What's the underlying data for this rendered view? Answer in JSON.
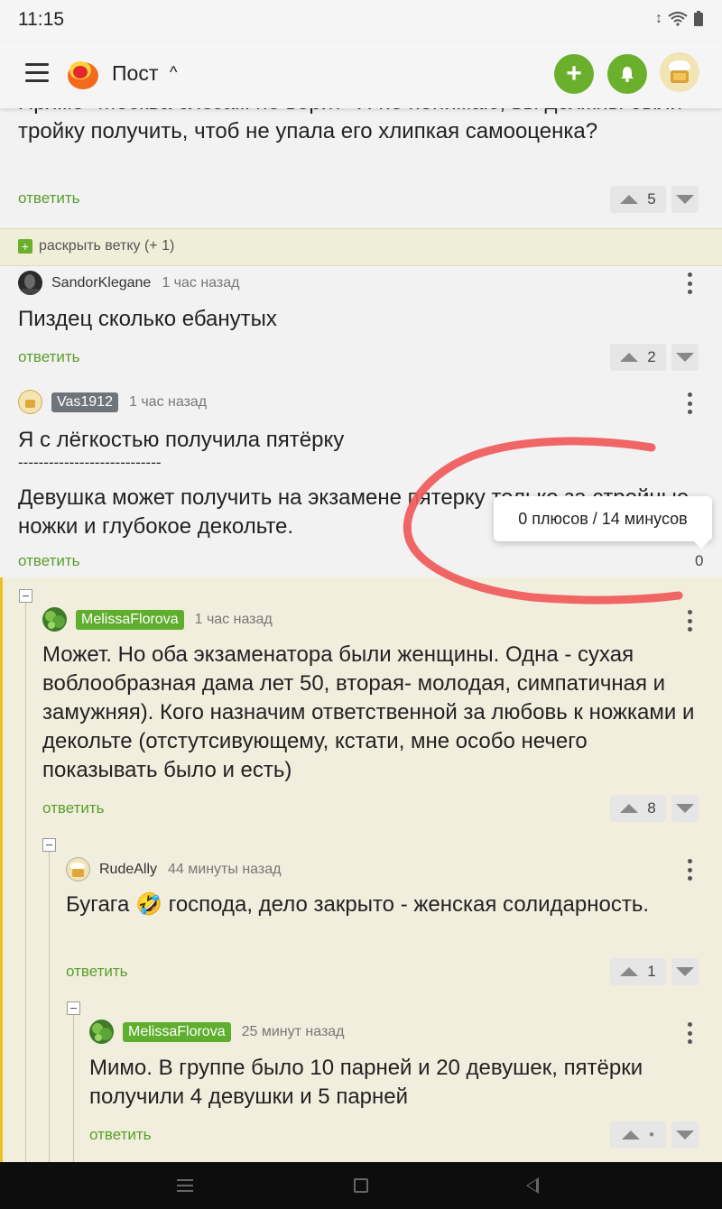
{
  "status_bar": {
    "time": "11:15",
    "icons": [
      "brightness-icon",
      "wifi-icon",
      "battery-icon"
    ]
  },
  "header": {
    "title": "Пост",
    "chevron": "^",
    "add_label": "+"
  },
  "top_comment": {
    "text": "Прямо \"Москва слезам не верит\" Я не понимаю, вы должны были тройку получить, чтоб не упала его хлипкая самооценка?",
    "reply": "ответить",
    "score": "5"
  },
  "expand_branch": {
    "label": "раскрыть ветку (+ 1)"
  },
  "comments": [
    {
      "user": "SandorKlegane",
      "time": "1 час назад",
      "text": "Пиздец сколько ебанутых",
      "reply": "ответить",
      "score": "2"
    },
    {
      "user": "Vas1912",
      "time": "1 час назад",
      "text_line1": "Я с лёгкостью получила пятёрку",
      "separator": "----------------------------",
      "text_line2": "Девушка может получить на экзамене пятерку только за стройные ножки и глубокое декольте.",
      "reply": "ответить",
      "score": "0",
      "tooltip": "0 плюсов / 14 минусов"
    },
    {
      "user": "MelissaFlorova",
      "time": "1 час назад",
      "text": "Может. Но оба экзаменатора были женщины. Одна - сухая воблообразная дама лет 50, вторая- молодая, симпатичная и замужняя). Кого назначим ответственной за любовь к ножками и декольте (отстутсивующему, кстати, мне особо нечего показывать было и есть)",
      "reply": "ответить",
      "score": "8"
    },
    {
      "user": "RudeAlly",
      "time": "44 минуты назад",
      "text": "Бугага 🤣 господа, дело закрыто - женская солидарность.",
      "reply": "ответить",
      "score": "1"
    },
    {
      "user": "MelissaFlorova",
      "time": "25 минут назад",
      "text": "Мимо. В группе было 10 парней и 20 девушек, пятёрки получили 4 девушки и 5 парней",
      "reply": "ответить",
      "score": "•"
    }
  ],
  "colors": {
    "accent_green": "#6bb02c",
    "thread_yellow": "#f0c020",
    "thread_bg": "#f1eedd",
    "scribble": "#f05a5a"
  }
}
